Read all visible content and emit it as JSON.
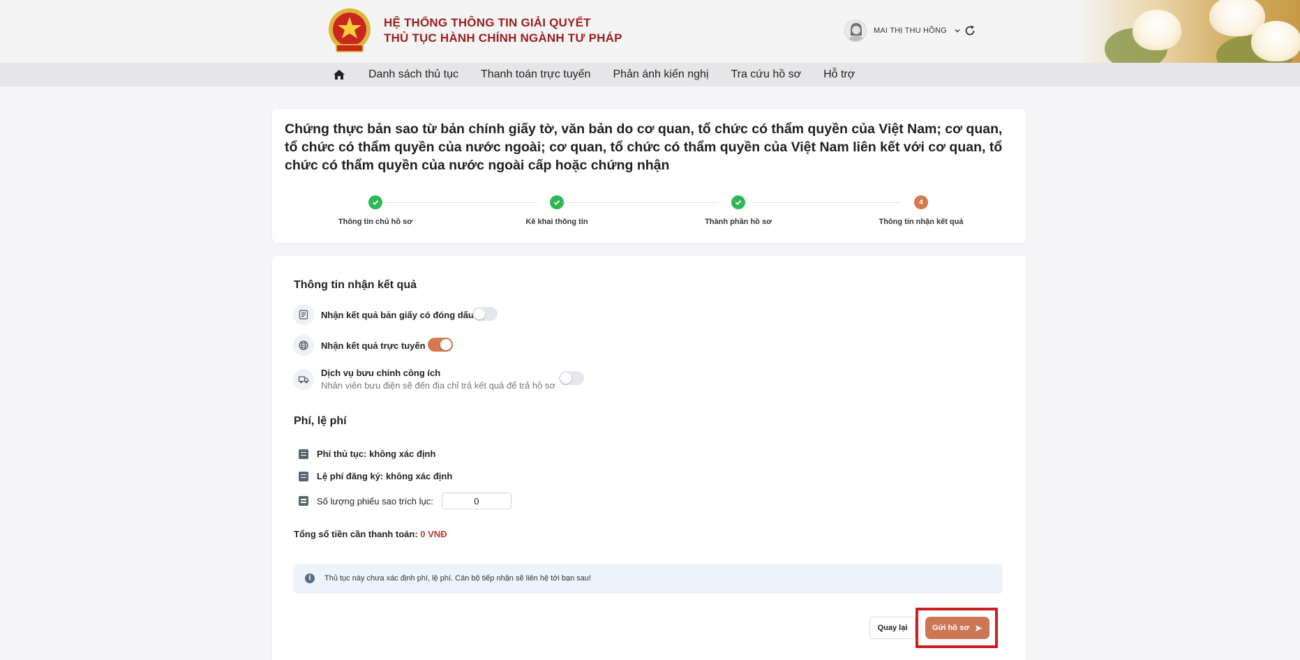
{
  "header": {
    "brand_line1": "HỆ THỐNG THÔNG TIN GIẢI QUYẾT",
    "brand_line2": "THỦ TỤC HÀNH CHÍNH NGÀNH TƯ PHÁP",
    "user_name": "MAI THỊ THU HỒNG",
    "icons": {
      "emblem": "national-emblem-icon",
      "avatar": "user-avatar",
      "chevron": "chevron-down-icon",
      "refresh": "refresh-icon"
    }
  },
  "nav": {
    "home_icon": "home-icon",
    "items": [
      {
        "label": "Danh sách thủ tục"
      },
      {
        "label": "Thanh toán trực tuyến"
      },
      {
        "label": "Phản ánh kiến nghị"
      },
      {
        "label": "Tra cứu hồ sơ"
      },
      {
        "label": "Hỗ trợ"
      }
    ]
  },
  "procedure": {
    "title": "Chứng thực bản sao từ bản chính giấy tờ, văn bản do cơ quan, tổ chức có thẩm quyền của Việt Nam; cơ quan, tổ chức có thẩm quyền của nước ngoài; cơ quan, tổ chức có thẩm quyền của Việt Nam liên kết với cơ quan, tổ chức có thẩm quyền của nước ngoài cấp hoặc chứng nhận",
    "steps": [
      {
        "label": "Thông tin chủ hồ sơ",
        "status": "done"
      },
      {
        "label": "Kê khai thông tin",
        "status": "done"
      },
      {
        "label": "Thành phần hồ sơ",
        "status": "done"
      },
      {
        "label": "Thông tin nhận kết quả",
        "status": "active",
        "number": "4"
      }
    ]
  },
  "result": {
    "section_title": "Thông tin nhận kết quả",
    "options": [
      {
        "label": "Nhận kết quả bản giấy có đóng dấu",
        "icon": "document-icon",
        "enabled": false
      },
      {
        "label": "Nhận kết quả trực tuyến",
        "icon": "globe-icon",
        "enabled": true
      },
      {
        "label": "Dịch vụ bưu chính công ích",
        "sublabel": "Nhân viên bưu điện sẽ đến địa chỉ trả kết quả để trả hồ sơ",
        "icon": "delivery-truck-icon",
        "enabled": false
      }
    ]
  },
  "fees": {
    "section_title": "Phí, lệ phí",
    "procedure_fee": "Phí thủ tục: không xác định",
    "registration_fee": "Lệ phí đăng ký: không xác định",
    "copy_count_label": "Số lượng phiếu sao trích lục:",
    "copy_count_value": "0",
    "total_label": "Tổng số tiền cần thanh toán:",
    "total_value": "0 VNĐ"
  },
  "notice": {
    "text": "Thủ tục này chưa xác định phí, lệ phí. Cán bộ tiếp nhận sẽ liên hệ tới bạn sau!",
    "icon": "info-icon"
  },
  "actions": {
    "back_label": "Quay lại",
    "submit_label": "Gửi hồ sơ",
    "submit_icon": "send-icon"
  },
  "colors": {
    "accent": "#cc7656",
    "brand_red": "#9a1f1f",
    "success": "#2fb756",
    "highlight": "#cc1f1f"
  }
}
